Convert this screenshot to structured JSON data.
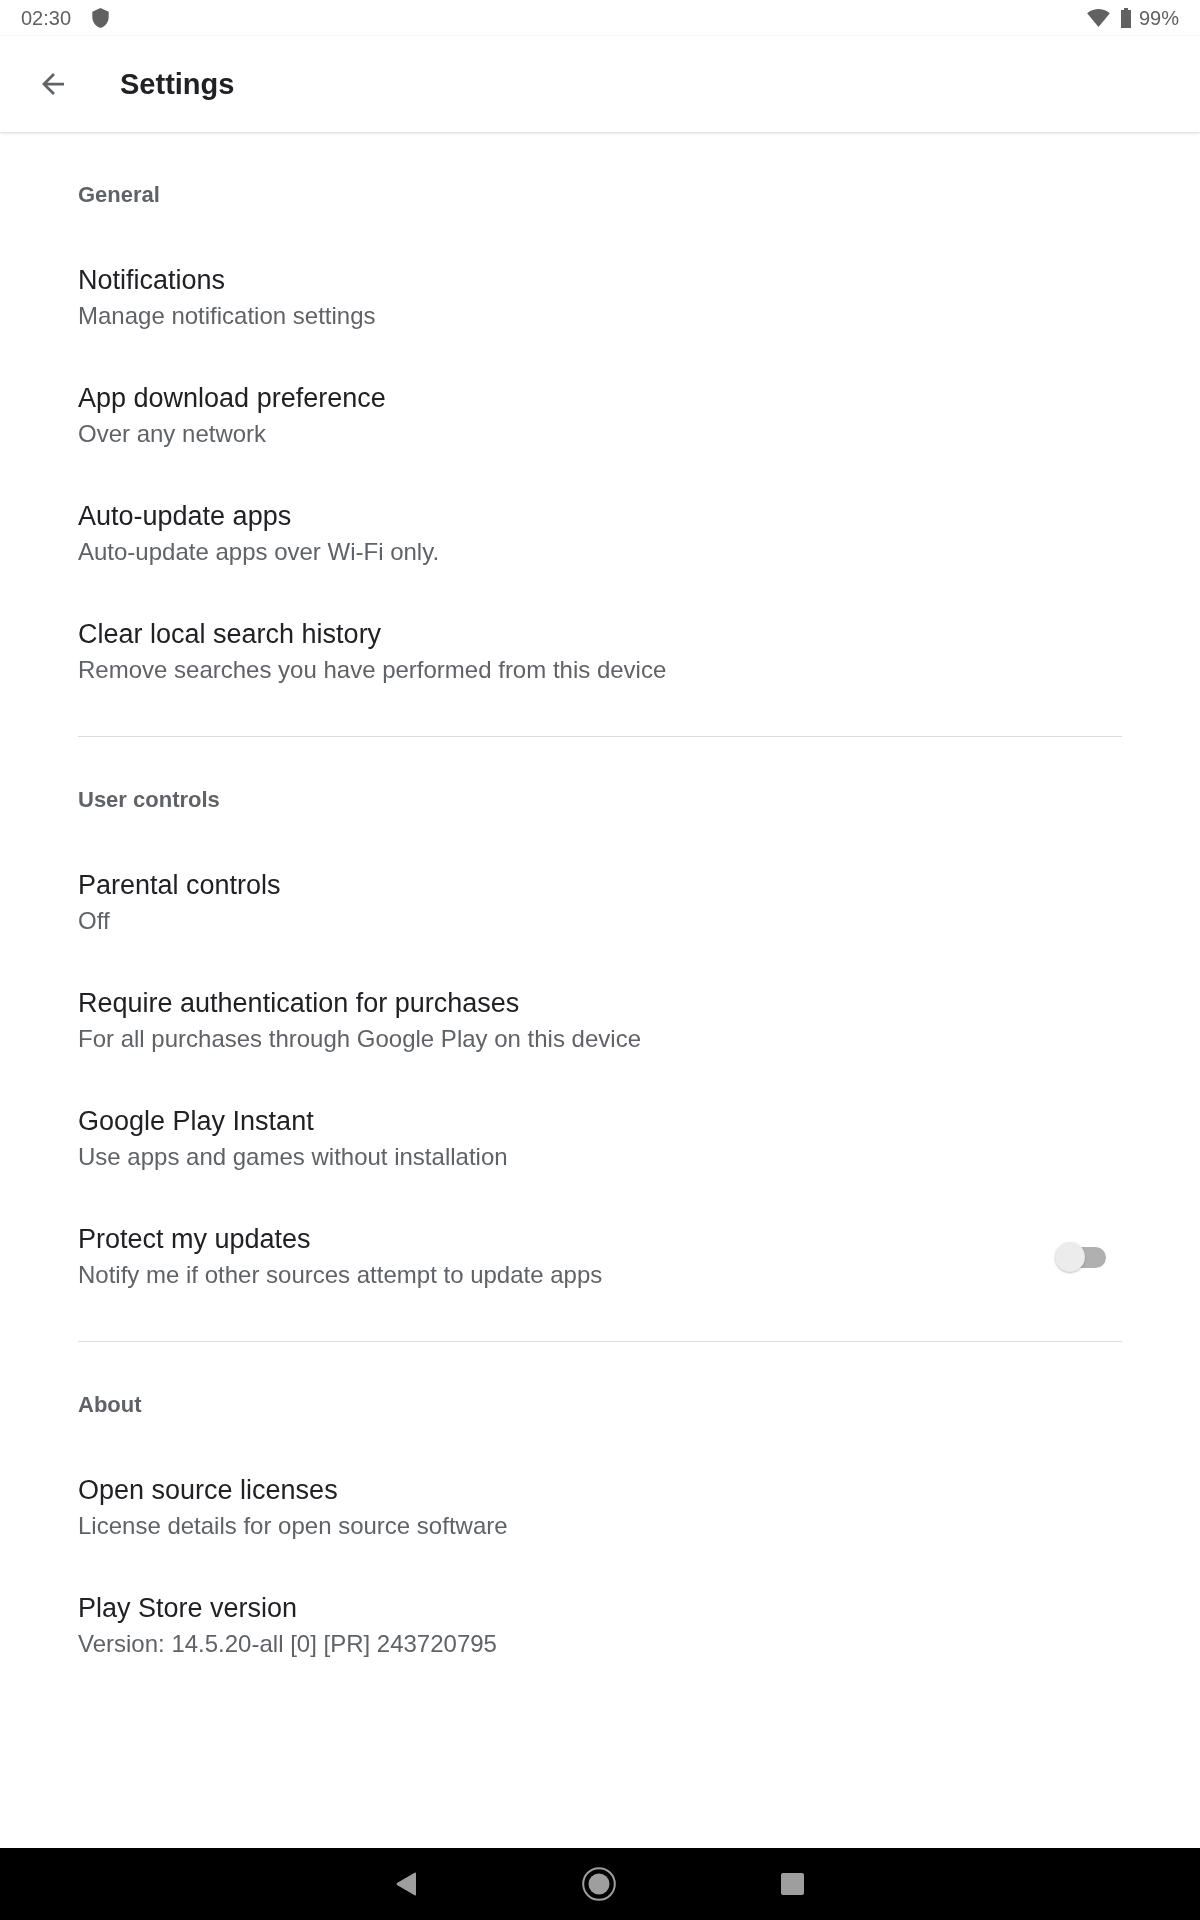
{
  "status_bar": {
    "time": "02:30",
    "battery": "99%"
  },
  "app_bar": {
    "title": "Settings"
  },
  "sections": [
    {
      "header": "General",
      "items": [
        {
          "kind": "plain",
          "title": "Notifications",
          "subtitle": "Manage notification settings"
        },
        {
          "kind": "plain",
          "title": "App download preference",
          "subtitle": "Over any network"
        },
        {
          "kind": "plain",
          "title": "Auto-update apps",
          "subtitle": "Auto-update apps over Wi-Fi only."
        },
        {
          "kind": "plain",
          "title": "Clear local search history",
          "subtitle": "Remove searches you have performed from this device"
        }
      ]
    },
    {
      "header": "User controls",
      "items": [
        {
          "kind": "plain",
          "title": "Parental controls",
          "subtitle": "Off"
        },
        {
          "kind": "plain",
          "title": "Require authentication for purchases",
          "subtitle": "For all purchases through Google Play on this device"
        },
        {
          "kind": "plain",
          "title": "Google Play Instant",
          "subtitle": "Use apps and games without installation"
        },
        {
          "kind": "toggle",
          "title": "Protect my updates",
          "subtitle": "Notify me if other sources attempt to update apps",
          "on": false
        }
      ]
    },
    {
      "header": "About",
      "items": [
        {
          "kind": "plain",
          "title": "Open source licenses",
          "subtitle": "License details for open source software"
        },
        {
          "kind": "plain",
          "title": "Play Store version",
          "subtitle": "Version: 14.5.20-all [0] [PR] 243720795"
        }
      ]
    }
  ]
}
